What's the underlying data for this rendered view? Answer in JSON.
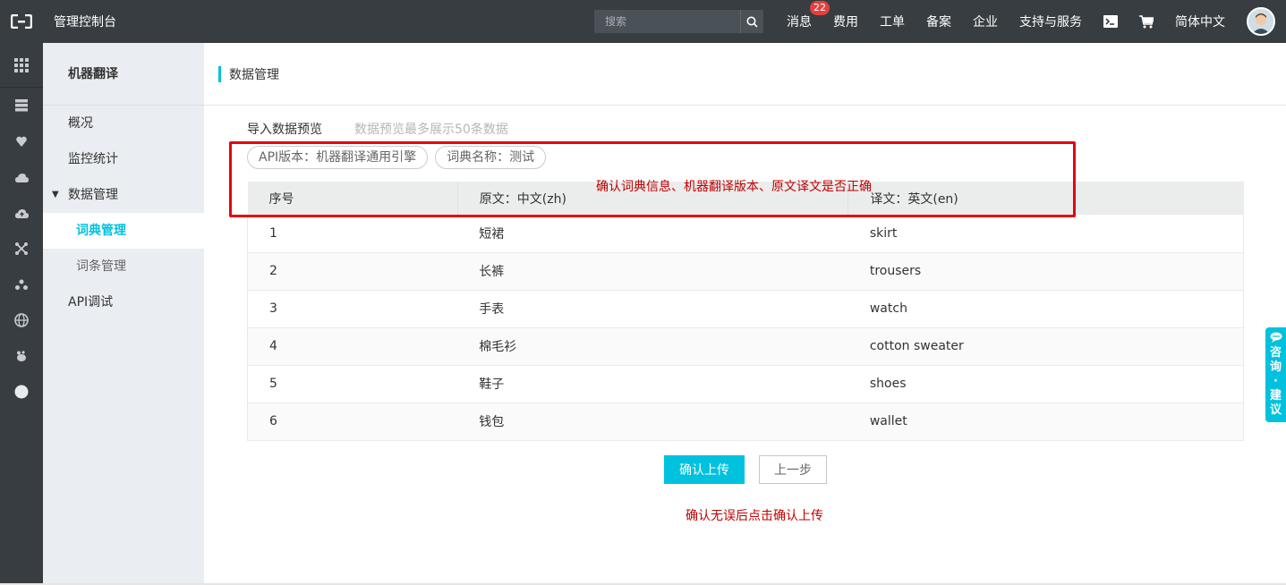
{
  "topbar": {
    "title": "管理控制台",
    "search_placeholder": "搜索",
    "nav": {
      "messages": "消息",
      "messages_count": "22",
      "billing": "费用",
      "tickets": "工单",
      "icp": "备案",
      "enterprise": "企业",
      "support": "支持与服务",
      "language": "简体中文"
    }
  },
  "sidebar": {
    "title": "机器翻译",
    "items": {
      "overview": "概况",
      "monitor": "监控统计",
      "data_mgmt": "数据管理",
      "dict_mgmt": "词典管理",
      "entry_mgmt": "词条管理",
      "api_debug": "API调试"
    }
  },
  "main": {
    "page_title": "数据管理",
    "preview_title": "导入数据预览",
    "preview_hint": "数据预览最多展示50条数据",
    "tags": {
      "api_version": "API版本：机器翻译通用引擎",
      "dict_name": "词典名称：测试"
    },
    "table": {
      "headers": [
        "序号",
        "原文：中文(zh)",
        "译文：英文(en)"
      ],
      "rows": [
        [
          "1",
          "短裙",
          "skirt"
        ],
        [
          "2",
          "长裤",
          "trousers"
        ],
        [
          "3",
          "手表",
          "watch"
        ],
        [
          "4",
          "棉毛衫",
          "cotton sweater"
        ],
        [
          "5",
          "鞋子",
          "shoes"
        ],
        [
          "6",
          "钱包",
          "wallet"
        ]
      ]
    },
    "annotation_top": "确认词典信息、机器翻译版本、原文译文是否正确",
    "confirm_button": "确认上传",
    "back_button": "上一步",
    "annotation_bottom": "确认无误后点击确认上传"
  },
  "consult": {
    "label": "咨询·建议"
  },
  "colors": {
    "accent": "#00c1de",
    "topbar_bg": "#373d41",
    "annotation_red": "#e60012"
  }
}
